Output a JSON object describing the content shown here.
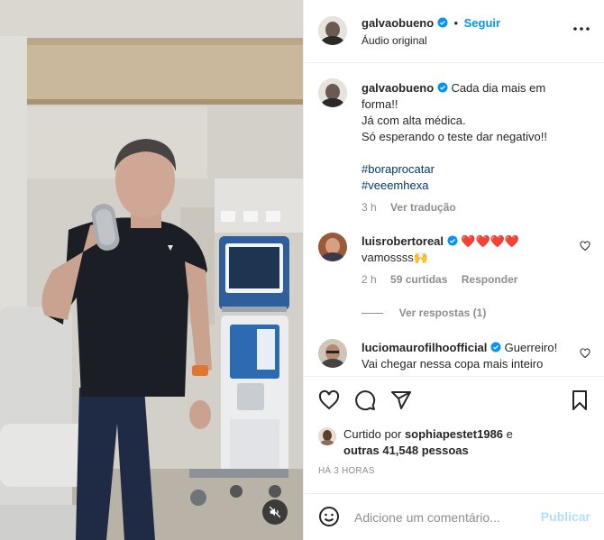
{
  "header": {
    "username": "galvaobueno",
    "separator": "•",
    "follow_label": "Seguir",
    "audio_label": "Áudio original",
    "more_icon": "more-options-icon"
  },
  "caption": {
    "username": "galvaobueno",
    "line1": "Cada dia mais em",
    "line2": "forma!!",
    "line3": "Já com alta médica.",
    "line4": "Só esperando o teste dar negativo!!",
    "hashtag1": "#boraprocatar",
    "hashtag2": "#veeemhexa",
    "time": "3 h",
    "translate_label": "Ver tradução"
  },
  "comments": [
    {
      "username": "luisrobertoreal",
      "text_line1": "❤️❤️❤️❤️",
      "text_line2": "vamossss🙌",
      "time": "2 h",
      "likes": "59 curtidas",
      "reply_label": "Responder",
      "replies_label": "Ver respostas (1)"
    },
    {
      "username": "luciomaurofilhoofficial",
      "text_line1": "Guerreiro!",
      "text_line2": "Vai chegar nessa copa mais inteiro"
    }
  ],
  "likes": {
    "prefix": "Curtido por",
    "user": "sophiapestet1986",
    "conj": "e",
    "others": "outras 41,548 pessoas"
  },
  "posted": "HÁ 3 HORAS",
  "add_comment": {
    "placeholder": "Adicione um comentário...",
    "publish_label": "Publicar"
  },
  "colors": {
    "accent": "#0095f6",
    "text": "#262626",
    "secondary": "#8e8e8e",
    "heart": "#ed4956",
    "publish_disabled": "#b2dffc"
  }
}
